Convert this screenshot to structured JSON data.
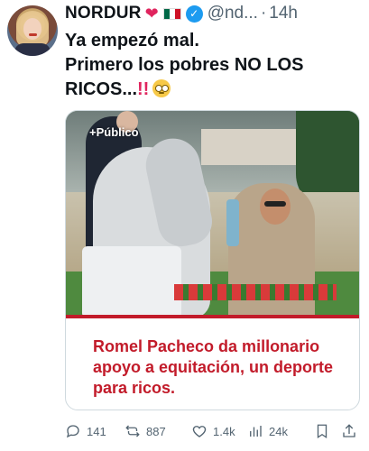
{
  "author": {
    "name": "NORDUR",
    "handle": "@nd...",
    "separator": "·",
    "time": "14h",
    "badges": [
      "heart-emoji",
      "mexico-flag-emoji",
      "verified-badge"
    ]
  },
  "tweet": {
    "line1": "Ya empezó mal.",
    "line2": "Primero los pobres NO LOS",
    "line3": "RICOS...",
    "emoji": [
      "double-exclamation",
      "rolling-eyes"
    ]
  },
  "card": {
    "watermark": "+Público",
    "headline": "Romel Pacheco da millonario apoyo a equitación, un deporte para ricos.",
    "accent_color": "#c21b2a"
  },
  "actions": {
    "replies": "141",
    "reposts": "887",
    "likes": "1.4k",
    "views": "24k"
  },
  "colors": {
    "text": "#0f1419",
    "muted": "#536471",
    "verified": "#1d9bf0",
    "heart": "#e0245e"
  }
}
